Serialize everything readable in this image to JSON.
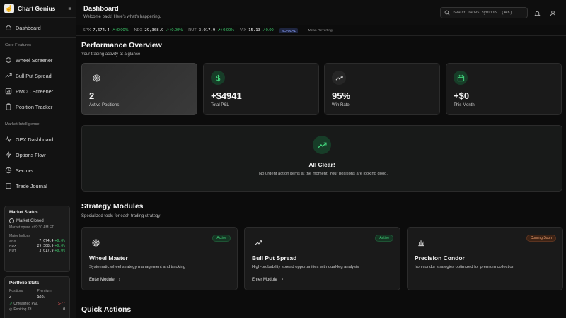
{
  "app": {
    "name": "Chart Genius",
    "logo_glyph": "☝"
  },
  "sidebar": {
    "dashboard_label": "Dashboard",
    "core_label": "Core Features",
    "core_items": [
      {
        "label": "Wheel Screener",
        "icon": "refresh-icon"
      },
      {
        "label": "Bull Put Spread",
        "icon": "trending-up-icon"
      },
      {
        "label": "PMCC Screener",
        "icon": "chart-square-icon"
      },
      {
        "label": "Position Tracker",
        "icon": "clipboard-icon"
      }
    ],
    "market_label": "Market Intelligence",
    "market_items": [
      {
        "label": "GEX Dashboard",
        "icon": "activity-icon"
      },
      {
        "label": "Options Flow",
        "icon": "zap-icon"
      },
      {
        "label": "Sectors",
        "icon": "pie-icon"
      },
      {
        "label": "Trade Journal",
        "icon": "book-icon"
      }
    ],
    "market_status": {
      "title": "Market Status",
      "status": "Market Closed",
      "opens": "Market opens at 9:30 AM ET",
      "major_label": "Major Indices",
      "indices": [
        {
          "name": "SPX",
          "value": "7,674.4",
          "change": "+0.0%"
        },
        {
          "name": "NDX",
          "value": "29,308.9",
          "change": "+0.0%"
        },
        {
          "name": "RUT",
          "value": "3,017.9",
          "change": "+0.0%"
        }
      ]
    },
    "portfolio_stats": {
      "title": "Portfolio Stats",
      "positions_label": "Positions",
      "positions_value": "2",
      "premium_label": "Premium",
      "premium_value": "$337",
      "unrealized_label": "Unrealized P&L",
      "unrealized_value": "$-77",
      "expiring_label": "Expiring 7d",
      "expiring_value": "0"
    }
  },
  "header": {
    "title": "Dashboard",
    "subtitle": "Welcome back! Here's what's happening.",
    "search_placeholder": "Search trades, symbols... (⌘K)"
  },
  "ticker": {
    "items": [
      {
        "name": "SPX",
        "value": "7,674.4",
        "change": "+0.00%"
      },
      {
        "name": "NDX",
        "value": "29,308.9",
        "change": "+0.00%"
      },
      {
        "name": "RUT",
        "value": "3,017.9",
        "change": "+0.00%"
      },
      {
        "name": "VIX",
        "value": "15.13",
        "change": "0.00"
      }
    ],
    "regime_badge": "NORMAL",
    "regime_note": "Mean-Reverting"
  },
  "performance": {
    "title": "Performance Overview",
    "subtitle": "Your trading activity at a glance",
    "cards": [
      {
        "value": "2",
        "label": "Active Positions",
        "icon": "target-icon"
      },
      {
        "value": "+$4941",
        "label": "Total P&L",
        "icon": "dollar-icon"
      },
      {
        "value": "95%",
        "label": "Win Rate",
        "icon": "trending-up-icon"
      },
      {
        "value": "+$0",
        "label": "This Month",
        "icon": "calendar-icon"
      }
    ]
  },
  "all_clear": {
    "title": "All Clear!",
    "message": "No urgent action items at the moment. Your positions are looking good."
  },
  "strategy": {
    "title": "Strategy Modules",
    "subtitle": "Specialized tools for each trading strategy",
    "modules": [
      {
        "title": "Wheel Master",
        "desc": "Systematic wheel strategy management and tracking",
        "badge": "Active",
        "enter": "Enter Module"
      },
      {
        "title": "Bull Put Spread",
        "desc": "High-probability spread opportunities with dual-leg analysis",
        "badge": "Active",
        "enter": "Enter Module"
      },
      {
        "title": "Precision Condor",
        "desc": "Iron condor strategies optimized for premium collection",
        "badge": "Coming Soon",
        "enter": ""
      }
    ]
  },
  "quick_actions": {
    "title": "Quick Actions"
  },
  "colors": {
    "accent_green": "#3ecf6e",
    "negative_red": "#e05757",
    "coming_soon": "#f0a070"
  }
}
